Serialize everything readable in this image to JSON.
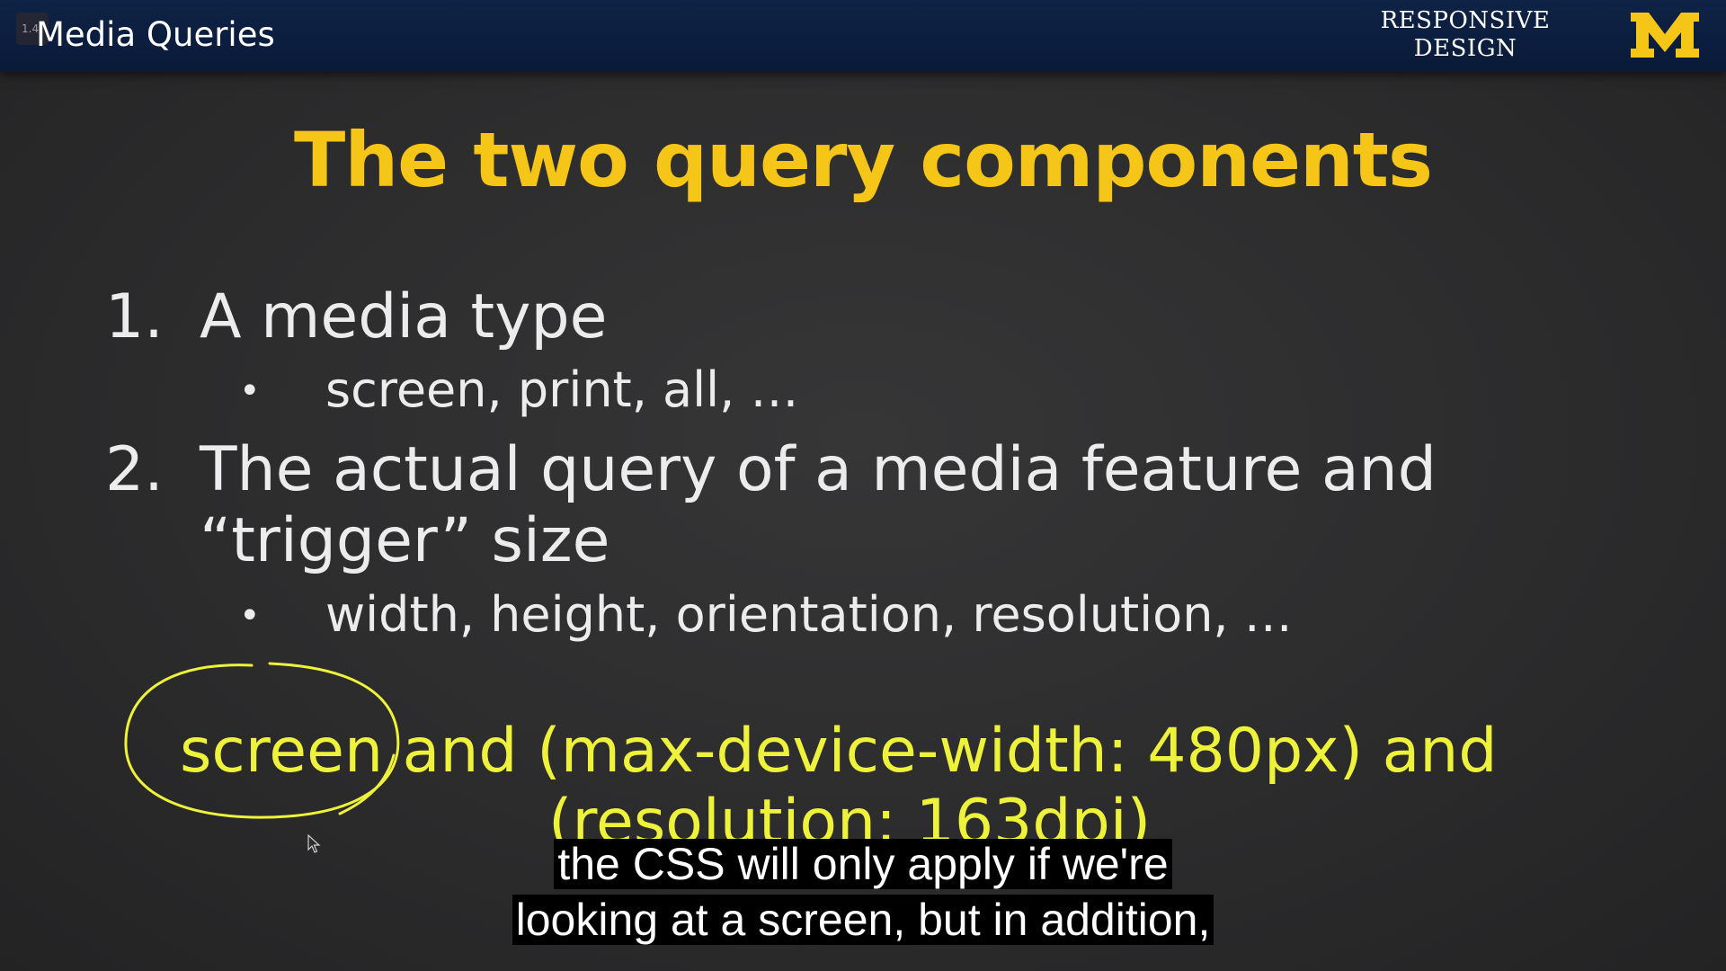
{
  "header": {
    "player_badge": "1.4",
    "title": "Media Queries",
    "brand_line1": "RESPONSIVE",
    "brand_line2": "DESIGN",
    "logo_letter": "M",
    "logo_color": "#f5c518"
  },
  "slide": {
    "title": "The two query components",
    "items": [
      {
        "number": "1.",
        "text": "A media type",
        "bullet": "•",
        "subtext": "screen, print, all, …"
      },
      {
        "number": "2.",
        "text_line1": "The actual query of a media feature and",
        "text_line2": "“trigger” size",
        "bullet": "•",
        "subtext": "width, height, orientation, resolution, …"
      }
    ],
    "example_line1": "screen and (max-device-width: 480px) and",
    "example_line2": "(resolution: 163dpi)",
    "title_color": "#f5c518",
    "example_color": "#eef23a"
  },
  "captions": {
    "line1": "the CSS will only apply if we're",
    "line2": "looking at a screen, but in addition,"
  }
}
